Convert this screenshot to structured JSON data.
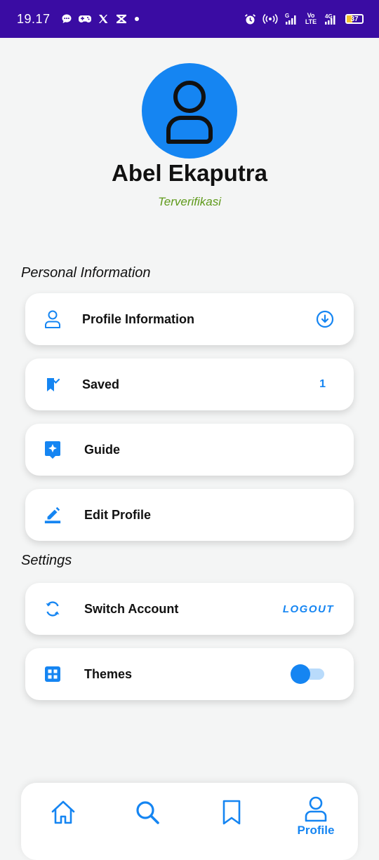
{
  "status_bar": {
    "time": "19.17",
    "signal_1_label": "G",
    "volte_label": "Vo LTE",
    "network_label": "4G",
    "battery_level": "37"
  },
  "profile": {
    "name": "Abel Ekaputra",
    "status": "Terverifikasi"
  },
  "sections": {
    "personal": "Personal Information",
    "settings": "Settings"
  },
  "menu": {
    "profile_information": "Profile Information",
    "saved": "Saved",
    "saved_count": "1",
    "guide": "Guide",
    "edit_profile": "Edit Profile",
    "switch_account": "Switch Account",
    "logout": "LOGOUT",
    "themes": "Themes",
    "themes_enabled": false
  },
  "bottom_nav": {
    "items": [
      {
        "icon": "home-icon",
        "label": ""
      },
      {
        "icon": "search-icon",
        "label": ""
      },
      {
        "icon": "bookmark-icon",
        "label": ""
      },
      {
        "icon": "profile-icon",
        "label": "Profile"
      }
    ]
  },
  "colors": {
    "accent": "#1585f2",
    "status_bar": "#3a0ca3",
    "verified": "#5f9a1b",
    "background": "#f4f5f5"
  }
}
